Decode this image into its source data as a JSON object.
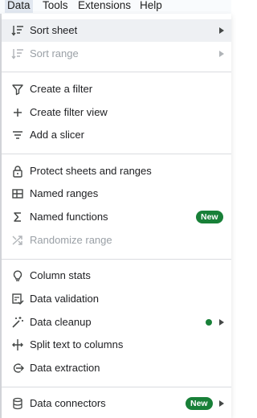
{
  "menubar": {
    "items": [
      {
        "label": "Data"
      },
      {
        "label": "Tools"
      },
      {
        "label": "Extensions"
      },
      {
        "label": "Help"
      }
    ]
  },
  "menu": {
    "sort_sheet": {
      "label": "Sort sheet",
      "icon": "sort-icon"
    },
    "sort_range": {
      "label": "Sort range",
      "icon": "sort-range-icon"
    },
    "create_filter": {
      "label": "Create a filter",
      "icon": "filter-icon"
    },
    "create_filter_view": {
      "label": "Create filter view",
      "icon": "plus-icon"
    },
    "add_slicer": {
      "label": "Add a slicer",
      "icon": "slicer-icon"
    },
    "protect": {
      "label": "Protect sheets and ranges",
      "icon": "lock-icon"
    },
    "named_ranges": {
      "label": "Named ranges",
      "icon": "table-icon"
    },
    "named_functions": {
      "label": "Named functions",
      "icon": "sigma-icon",
      "badge": "New"
    },
    "randomize": {
      "label": "Randomize range",
      "icon": "shuffle-icon"
    },
    "column_stats": {
      "label": "Column stats",
      "icon": "lightbulb-icon"
    },
    "data_validation": {
      "label": "Data validation",
      "icon": "validation-icon"
    },
    "data_cleanup": {
      "label": "Data cleanup",
      "icon": "magic-wand-icon"
    },
    "split_text": {
      "label": "Split text to columns",
      "icon": "split-icon"
    },
    "data_extraction": {
      "label": "Data extraction",
      "icon": "extraction-icon"
    },
    "data_connectors": {
      "label": "Data connectors",
      "icon": "database-icon",
      "badge": "New"
    }
  },
  "colors": {
    "badge": "#188038",
    "hover": "#eef0f3",
    "disabled": "#9aa0a6",
    "divider": "#dadce0"
  }
}
